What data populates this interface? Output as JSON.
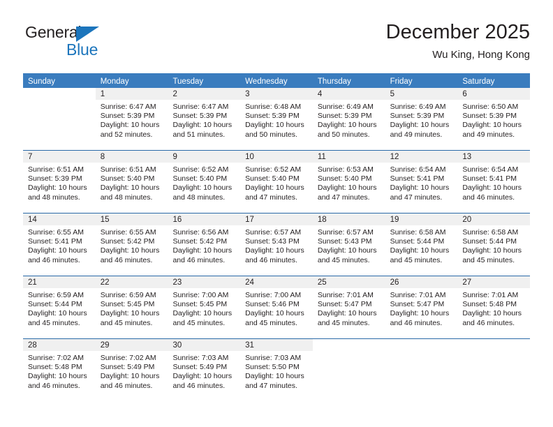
{
  "brand": {
    "name_top": "General",
    "name_bottom": "Blue",
    "triangle_color": "#1c75bc"
  },
  "header": {
    "title": "December 2025",
    "subtitle": "Wu King, Hong Kong"
  },
  "theme": {
    "header_blue": "#3a7cbe",
    "day_strip_gray": "#f0f0f0",
    "text_color": "#231f20"
  },
  "labels": {
    "sunrise_prefix": "Sunrise:",
    "sunset_prefix": "Sunset:",
    "daylight_prefix": "Daylight:"
  },
  "weekdays": [
    "Sunday",
    "Monday",
    "Tuesday",
    "Wednesday",
    "Thursday",
    "Friday",
    "Saturday"
  ],
  "weeks": [
    [
      {
        "day": "",
        "empty": true
      },
      {
        "day": "1",
        "sunrise": "Sunrise: 6:47 AM",
        "sunset": "Sunset: 5:39 PM",
        "daylight": "Daylight: 10 hours and 52 minutes."
      },
      {
        "day": "2",
        "sunrise": "Sunrise: 6:47 AM",
        "sunset": "Sunset: 5:39 PM",
        "daylight": "Daylight: 10 hours and 51 minutes."
      },
      {
        "day": "3",
        "sunrise": "Sunrise: 6:48 AM",
        "sunset": "Sunset: 5:39 PM",
        "daylight": "Daylight: 10 hours and 50 minutes."
      },
      {
        "day": "4",
        "sunrise": "Sunrise: 6:49 AM",
        "sunset": "Sunset: 5:39 PM",
        "daylight": "Daylight: 10 hours and 50 minutes."
      },
      {
        "day": "5",
        "sunrise": "Sunrise: 6:49 AM",
        "sunset": "Sunset: 5:39 PM",
        "daylight": "Daylight: 10 hours and 49 minutes."
      },
      {
        "day": "6",
        "sunrise": "Sunrise: 6:50 AM",
        "sunset": "Sunset: 5:39 PM",
        "daylight": "Daylight: 10 hours and 49 minutes."
      }
    ],
    [
      {
        "day": "7",
        "sunrise": "Sunrise: 6:51 AM",
        "sunset": "Sunset: 5:39 PM",
        "daylight": "Daylight: 10 hours and 48 minutes."
      },
      {
        "day": "8",
        "sunrise": "Sunrise: 6:51 AM",
        "sunset": "Sunset: 5:40 PM",
        "daylight": "Daylight: 10 hours and 48 minutes."
      },
      {
        "day": "9",
        "sunrise": "Sunrise: 6:52 AM",
        "sunset": "Sunset: 5:40 PM",
        "daylight": "Daylight: 10 hours and 48 minutes."
      },
      {
        "day": "10",
        "sunrise": "Sunrise: 6:52 AM",
        "sunset": "Sunset: 5:40 PM",
        "daylight": "Daylight: 10 hours and 47 minutes."
      },
      {
        "day": "11",
        "sunrise": "Sunrise: 6:53 AM",
        "sunset": "Sunset: 5:40 PM",
        "daylight": "Daylight: 10 hours and 47 minutes."
      },
      {
        "day": "12",
        "sunrise": "Sunrise: 6:54 AM",
        "sunset": "Sunset: 5:41 PM",
        "daylight": "Daylight: 10 hours and 47 minutes."
      },
      {
        "day": "13",
        "sunrise": "Sunrise: 6:54 AM",
        "sunset": "Sunset: 5:41 PM",
        "daylight": "Daylight: 10 hours and 46 minutes."
      }
    ],
    [
      {
        "day": "14",
        "sunrise": "Sunrise: 6:55 AM",
        "sunset": "Sunset: 5:41 PM",
        "daylight": "Daylight: 10 hours and 46 minutes."
      },
      {
        "day": "15",
        "sunrise": "Sunrise: 6:55 AM",
        "sunset": "Sunset: 5:42 PM",
        "daylight": "Daylight: 10 hours and 46 minutes."
      },
      {
        "day": "16",
        "sunrise": "Sunrise: 6:56 AM",
        "sunset": "Sunset: 5:42 PM",
        "daylight": "Daylight: 10 hours and 46 minutes."
      },
      {
        "day": "17",
        "sunrise": "Sunrise: 6:57 AM",
        "sunset": "Sunset: 5:43 PM",
        "daylight": "Daylight: 10 hours and 46 minutes."
      },
      {
        "day": "18",
        "sunrise": "Sunrise: 6:57 AM",
        "sunset": "Sunset: 5:43 PM",
        "daylight": "Daylight: 10 hours and 45 minutes."
      },
      {
        "day": "19",
        "sunrise": "Sunrise: 6:58 AM",
        "sunset": "Sunset: 5:44 PM",
        "daylight": "Daylight: 10 hours and 45 minutes."
      },
      {
        "day": "20",
        "sunrise": "Sunrise: 6:58 AM",
        "sunset": "Sunset: 5:44 PM",
        "daylight": "Daylight: 10 hours and 45 minutes."
      }
    ],
    [
      {
        "day": "21",
        "sunrise": "Sunrise: 6:59 AM",
        "sunset": "Sunset: 5:44 PM",
        "daylight": "Daylight: 10 hours and 45 minutes."
      },
      {
        "day": "22",
        "sunrise": "Sunrise: 6:59 AM",
        "sunset": "Sunset: 5:45 PM",
        "daylight": "Daylight: 10 hours and 45 minutes."
      },
      {
        "day": "23",
        "sunrise": "Sunrise: 7:00 AM",
        "sunset": "Sunset: 5:45 PM",
        "daylight": "Daylight: 10 hours and 45 minutes."
      },
      {
        "day": "24",
        "sunrise": "Sunrise: 7:00 AM",
        "sunset": "Sunset: 5:46 PM",
        "daylight": "Daylight: 10 hours and 45 minutes."
      },
      {
        "day": "25",
        "sunrise": "Sunrise: 7:01 AM",
        "sunset": "Sunset: 5:47 PM",
        "daylight": "Daylight: 10 hours and 45 minutes."
      },
      {
        "day": "26",
        "sunrise": "Sunrise: 7:01 AM",
        "sunset": "Sunset: 5:47 PM",
        "daylight": "Daylight: 10 hours and 46 minutes."
      },
      {
        "day": "27",
        "sunrise": "Sunrise: 7:01 AM",
        "sunset": "Sunset: 5:48 PM",
        "daylight": "Daylight: 10 hours and 46 minutes."
      }
    ],
    [
      {
        "day": "28",
        "sunrise": "Sunrise: 7:02 AM",
        "sunset": "Sunset: 5:48 PM",
        "daylight": "Daylight: 10 hours and 46 minutes."
      },
      {
        "day": "29",
        "sunrise": "Sunrise: 7:02 AM",
        "sunset": "Sunset: 5:49 PM",
        "daylight": "Daylight: 10 hours and 46 minutes."
      },
      {
        "day": "30",
        "sunrise": "Sunrise: 7:03 AM",
        "sunset": "Sunset: 5:49 PM",
        "daylight": "Daylight: 10 hours and 46 minutes."
      },
      {
        "day": "31",
        "sunrise": "Sunrise: 7:03 AM",
        "sunset": "Sunset: 5:50 PM",
        "daylight": "Daylight: 10 hours and 47 minutes."
      },
      {
        "day": "",
        "empty": true
      },
      {
        "day": "",
        "empty": true
      },
      {
        "day": "",
        "empty": true
      }
    ]
  ]
}
